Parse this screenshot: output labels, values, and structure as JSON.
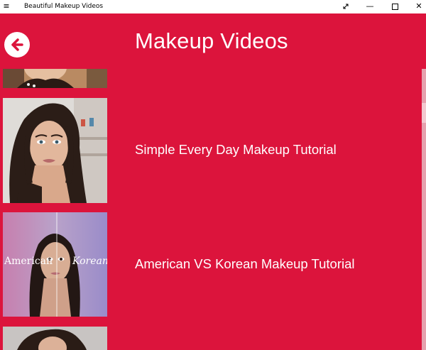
{
  "window": {
    "title": "Beautiful Makeup Videos",
    "menu_icon": "hamburger-icon",
    "expand_icon": "expand-icon",
    "minimize_icon": "minimize-icon",
    "maximize_icon": "maximize-icon",
    "close_icon": "close-icon"
  },
  "header": {
    "back_icon": "back-arrow-icon",
    "title": "Makeup Videos"
  },
  "videos": [
    {
      "title": ""
    },
    {
      "title": "Simple Every Day Makeup Tutorial"
    },
    {
      "title": "American VS Korean Makeup Tutorial",
      "thumb_left_text": "American",
      "thumb_right_text": "Korean"
    },
    {
      "title": ""
    }
  ],
  "colors": {
    "accent": "#dc143c",
    "scroll_track": "#e6a0ad"
  }
}
